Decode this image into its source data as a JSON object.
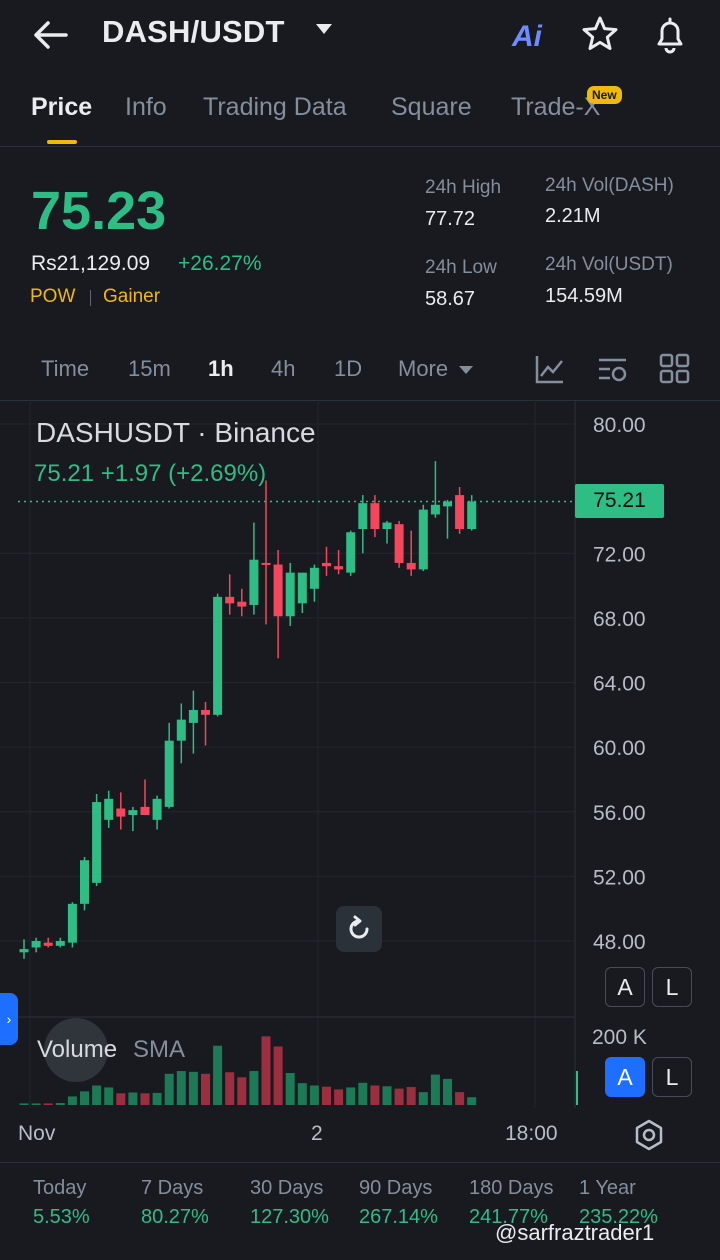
{
  "header": {
    "pair": "DASH/USDT",
    "ai_label": "Ai",
    "icons": [
      "back-arrow-icon",
      "caret-down-icon",
      "star-icon",
      "bell-icon"
    ]
  },
  "tabs": [
    {
      "label": "Price",
      "active": true
    },
    {
      "label": "Info"
    },
    {
      "label": "Trading Data"
    },
    {
      "label": "Square"
    },
    {
      "label": "Trade-X",
      "badge": "New"
    }
  ],
  "ticker": {
    "last_price": "75.23",
    "fiat_price": "Rs21,129.09",
    "change_pct": "+26.27%",
    "tags": [
      "POW",
      "Gainer"
    ],
    "high_label": "24h High",
    "high_value": "77.72",
    "low_label": "24h Low",
    "low_value": "58.67",
    "vol_base_label": "24h Vol(DASH)",
    "vol_base_value": "2.21M",
    "vol_quote_label": "24h Vol(USDT)",
    "vol_quote_value": "154.59M"
  },
  "intervals": {
    "items": [
      "Time",
      "15m",
      "1h",
      "4h",
      "1D"
    ],
    "active": "1h",
    "more_label": "More"
  },
  "chart": {
    "legend_title": "DASHUSDT · Binance",
    "legend_values": "75.21  +1.97 (+2.69%)",
    "current_price_tag": "75.21",
    "volume_label": "Volume",
    "volume_indicator": "SMA",
    "volume_scale_label": "200 K",
    "x_labels": [
      "Nov",
      "2",
      "18:00"
    ],
    "price_scale_btns": {
      "a": "A",
      "l": "L"
    },
    "volume_scale_btns": {
      "a": "A",
      "l": "L"
    }
  },
  "chart_data": {
    "type": "candlestick",
    "title": "DASHUSDT · Binance",
    "ylim": [
      46,
      82
    ],
    "y_ticks": [
      "80.00",
      "72.00",
      "68.00",
      "64.00",
      "60.00",
      "56.00",
      "52.00",
      "48.00"
    ],
    "x_labels": [
      "Nov",
      "2",
      "18:00"
    ],
    "up_color": "#2ebd85",
    "down_color": "#f6465d",
    "candles": [
      {
        "o": 47.3,
        "h": 48.1,
        "l": 46.9,
        "c": 47.5
      },
      {
        "o": 47.6,
        "h": 48.2,
        "l": 47.3,
        "c": 48.0
      },
      {
        "o": 47.9,
        "h": 48.2,
        "l": 47.6,
        "c": 47.7
      },
      {
        "o": 47.7,
        "h": 48.2,
        "l": 47.6,
        "c": 48.0
      },
      {
        "o": 47.9,
        "h": 50.4,
        "l": 47.6,
        "c": 50.3
      },
      {
        "o": 50.3,
        "h": 53.2,
        "l": 49.9,
        "c": 53.0
      },
      {
        "o": 51.6,
        "h": 57.1,
        "l": 51.4,
        "c": 56.6
      },
      {
        "o": 55.5,
        "h": 57.3,
        "l": 55.0,
        "c": 56.8
      },
      {
        "o": 56.2,
        "h": 57.2,
        "l": 54.9,
        "c": 55.7
      },
      {
        "o": 55.8,
        "h": 56.3,
        "l": 54.8,
        "c": 56.1
      },
      {
        "o": 56.3,
        "h": 58.0,
        "l": 55.8,
        "c": 55.8
      },
      {
        "o": 55.5,
        "h": 57.0,
        "l": 54.9,
        "c": 56.8
      },
      {
        "o": 56.3,
        "h": 61.5,
        "l": 56.2,
        "c": 60.4
      },
      {
        "o": 60.4,
        "h": 62.7,
        "l": 59.0,
        "c": 61.7
      },
      {
        "o": 61.5,
        "h": 63.5,
        "l": 59.6,
        "c": 62.3
      },
      {
        "o": 62.3,
        "h": 62.8,
        "l": 60.1,
        "c": 62.0
      },
      {
        "o": 62.0,
        "h": 69.5,
        "l": 61.9,
        "c": 69.3
      },
      {
        "o": 69.3,
        "h": 70.7,
        "l": 68.2,
        "c": 68.9
      },
      {
        "o": 69.0,
        "h": 69.8,
        "l": 68.1,
        "c": 68.7
      },
      {
        "o": 68.8,
        "h": 73.9,
        "l": 68.2,
        "c": 71.6
      },
      {
        "o": 71.4,
        "h": 76.5,
        "l": 67.6,
        "c": 71.3
      },
      {
        "o": 71.3,
        "h": 72.2,
        "l": 65.5,
        "c": 68.1
      },
      {
        "o": 68.1,
        "h": 71.4,
        "l": 67.5,
        "c": 70.8
      },
      {
        "o": 68.9,
        "h": 70.7,
        "l": 68.3,
        "c": 70.8
      },
      {
        "o": 69.8,
        "h": 71.3,
        "l": 69.0,
        "c": 71.1
      },
      {
        "o": 71.4,
        "h": 72.4,
        "l": 70.6,
        "c": 71.2
      },
      {
        "o": 71.2,
        "h": 72.2,
        "l": 70.7,
        "c": 71.0
      },
      {
        "o": 70.8,
        "h": 73.4,
        "l": 70.6,
        "c": 73.3
      },
      {
        "o": 73.5,
        "h": 75.6,
        "l": 72.0,
        "c": 75.1
      },
      {
        "o": 75.1,
        "h": 75.6,
        "l": 73.0,
        "c": 73.5
      },
      {
        "o": 73.5,
        "h": 74.0,
        "l": 72.6,
        "c": 73.9
      },
      {
        "o": 73.8,
        "h": 74.0,
        "l": 71.1,
        "c": 71.4
      },
      {
        "o": 71.4,
        "h": 73.4,
        "l": 70.6,
        "c": 71.0
      },
      {
        "o": 71.0,
        "h": 75.0,
        "l": 70.9,
        "c": 74.7
      },
      {
        "o": 74.4,
        "h": 77.7,
        "l": 74.2,
        "c": 75.0
      },
      {
        "o": 74.9,
        "h": 75.3,
        "l": 72.9,
        "c": 75.2
      },
      {
        "o": 75.6,
        "h": 76.1,
        "l": 73.2,
        "c": 73.5
      },
      {
        "o": 73.5,
        "h": 75.6,
        "l": 73.4,
        "c": 75.2
      }
    ],
    "volume_ylim": [
      0,
      200000
    ],
    "volume": [
      4000,
      4000,
      4000,
      5000,
      22000,
      35000,
      50000,
      45000,
      30000,
      32000,
      30000,
      31000,
      80000,
      87000,
      85000,
      80000,
      152000,
      84000,
      71000,
      87000,
      176000,
      150000,
      82000,
      56000,
      50000,
      47000,
      40000,
      45000,
      57000,
      50000,
      48000,
      42000,
      46000,
      33000,
      78000,
      67000,
      33000,
      20000
    ]
  },
  "performance": [
    {
      "label": "Today",
      "value": "5.53%"
    },
    {
      "label": "7 Days",
      "value": "80.27%"
    },
    {
      "label": "30 Days",
      "value": "127.30%"
    },
    {
      "label": "90 Days",
      "value": "267.14%"
    },
    {
      "label": "180 Days",
      "value": "241.77%"
    },
    {
      "label": "1 Year",
      "value": "235.22%"
    }
  ],
  "credit": "@sarfraztrader1",
  "colors": {
    "up": "#2ebd85",
    "down": "#f6465d",
    "accent": "#f0b90b",
    "background": "#181a20",
    "blue": "#1e6fff"
  }
}
